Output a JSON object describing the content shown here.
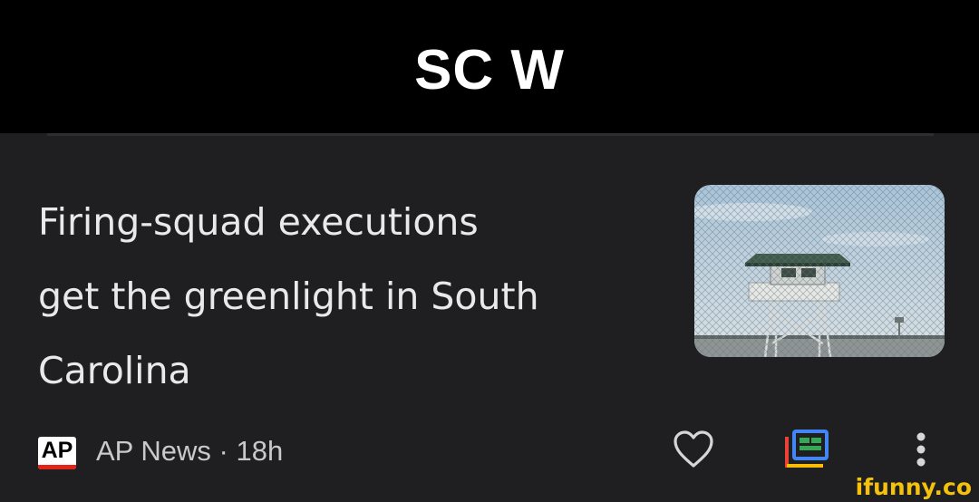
{
  "caption": {
    "text": "SC W"
  },
  "article": {
    "headline_lines": [
      "Firing-squad executions",
      "get the greenlight in South",
      "Carolina"
    ],
    "source_logo_text": "AP",
    "source": "AP News",
    "time_separator": "·",
    "age": "18h",
    "source_line": "AP News · 18h"
  },
  "icons": {
    "thumbnail": "prison-guard-tower-photo",
    "like": "heart-outline-icon",
    "full_coverage": "full-coverage-icon",
    "more": "more-vert-icon"
  },
  "watermark": {
    "text": "ifunny.co"
  },
  "colors": {
    "caption_bg": "#000000",
    "card_bg": "#1f1f21",
    "headline": "#e9e9eb",
    "meta_text": "#c9c9cc",
    "ap_red": "#e2231a",
    "watermark": "#f4c20d"
  }
}
